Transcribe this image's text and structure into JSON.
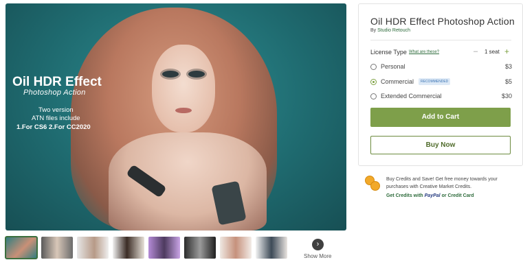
{
  "hero": {
    "title": "Oil HDR Effect",
    "subtitle": "Photoshop Action",
    "line1": "Two version",
    "line2": "ATN files include",
    "line3": "1.For CS6   2.For CC2020"
  },
  "gallery": {
    "show_more": "Show More",
    "next_icon": "›"
  },
  "product": {
    "title": "Oil HDR Effect Photoshop Action",
    "by_prefix": "By",
    "author": "Studio Retouch",
    "license_label": "License Type",
    "license_link": "What are these?",
    "seat_minus": "–",
    "seat_value": "1 seat",
    "seat_plus": "+",
    "options": [
      {
        "label": "Personal",
        "price": "$3",
        "selected": false
      },
      {
        "label": "Commercial",
        "price": "$5",
        "selected": true,
        "badge": "RECOMMENDED"
      },
      {
        "label": "Extended Commercial",
        "price": "$30",
        "selected": false
      }
    ],
    "add_to_cart": "Add to Cart",
    "buy_now": "Buy Now"
  },
  "credits": {
    "text": "Buy Credits and Save! Get free money towards your purchases with Creative Market Credits.",
    "link_prefix": "Get Credits with",
    "paypal": "PayPal",
    "link_suffix": "or Credit Card"
  },
  "colors": {
    "accent": "#7e9f4a",
    "link": "#2c6a3a",
    "badge_bg": "#dde9f6"
  }
}
